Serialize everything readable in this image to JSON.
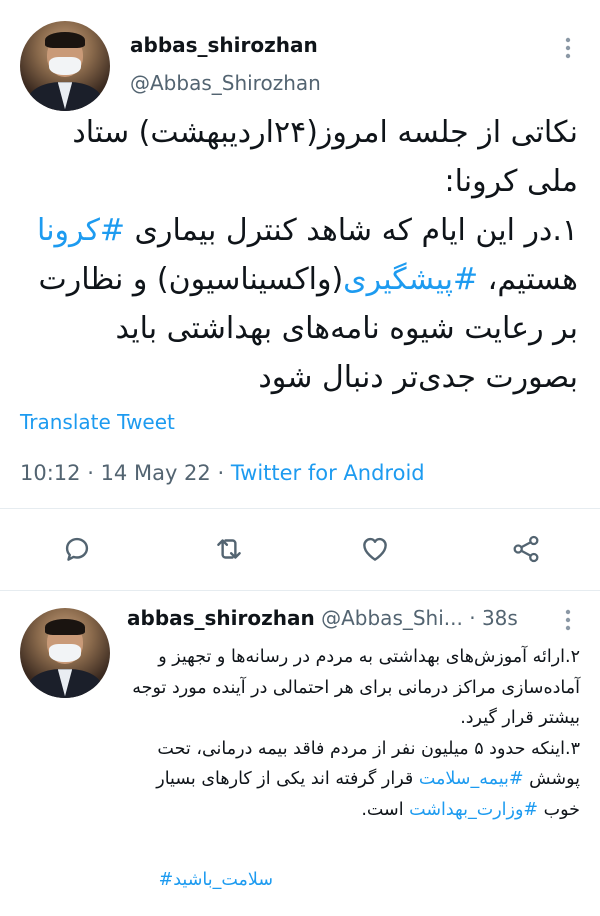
{
  "tweet": {
    "author_name": "abbas_shirozhan",
    "author_handle": "@Abbas_Shirozhan",
    "text_parts": [
      "نکاتی از جلسه امروز(۲۴اردیبهشت) ستاد ملی کرونا:",
      "۱.در این ایام که شاهد کنترل بیماری ",
      "#کرونا",
      " هستیم، ",
      "#پیشگیری",
      "(واکسیناسیون) و نظارت بر رعایت شیوه نامه‌های بهداشتی باید بصورت جدی‌تر دنبال شود"
    ],
    "translate_label": "Translate Tweet",
    "time": "10:12",
    "date": "14 May 22",
    "source": "Twitter for Android",
    "separator": " · ",
    "actions": {
      "reply_icon": "reply-icon",
      "retweet_icon": "retweet-icon",
      "like_icon": "heart-icon",
      "share_icon": "share-icon"
    }
  },
  "reply": {
    "author_name": "abbas_shirozhan",
    "author_handle": "@Abbas_Shi...",
    "time_ago": "38s",
    "separator": " · ",
    "text_parts": [
      "۲.ارائه آموزش‌های بهداشتی به مردم در رسانه‌ها و تجهیز و آماده‌سازی مراکز درمانی برای هر احتمالی در آینده مورد توجه بیشتر قرار گیرد.",
      "۳.اینکه حدود ۵ میلیون نفر از مردم فاقد بیمه درمانی، تحت پوشش ",
      "#بیمه_سلامت",
      " قرار گرفته اند یکی از کارهای بسیار خوب ",
      "#وزارت_بهداشت",
      " است.",
      "#سلامت_باشید"
    ]
  },
  "colors": {
    "link": "#1d9bf0",
    "secondary": "#536471",
    "primary": "#0f1419",
    "divider": "#e6ecf0"
  }
}
